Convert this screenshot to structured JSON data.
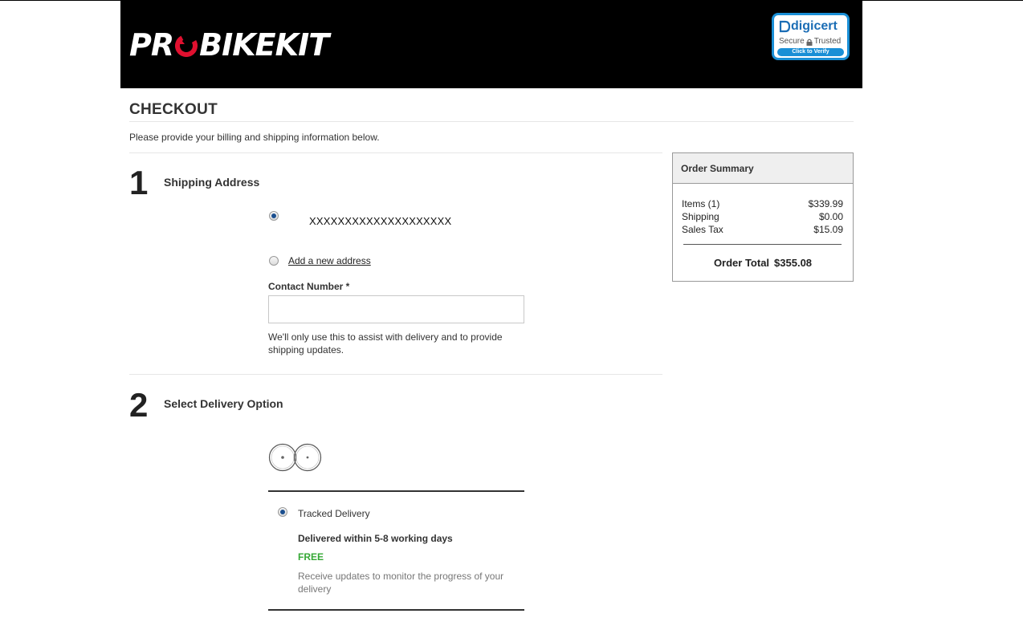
{
  "header": {
    "logo_before": "PR",
    "logo_after": "BIKEKIT",
    "seal": {
      "brand": "digicert",
      "secure": "Secure",
      "trusted": "Trusted",
      "verify": "Click to Verify"
    }
  },
  "checkout": {
    "title": "CHECKOUT",
    "intro": "Please provide your billing and shipping information below."
  },
  "shipping": {
    "step": "1",
    "title": "Shipping Address",
    "saved_address": "XXXXXXXXXXXXXXXXXXXX",
    "saved_address_selected": true,
    "add_new_label": "Add a new address",
    "contact_label": "Contact Number *",
    "contact_value": "",
    "contact_help": "We'll only use this to assist with delivery and to provide shipping updates."
  },
  "delivery": {
    "step": "2",
    "title": "Select Delivery Option",
    "option": {
      "name": "Tracked Delivery",
      "selected": true,
      "time": "Delivered within 5-8 working days",
      "price": "FREE",
      "description": "Receive updates to monitor the progress of your delivery"
    }
  },
  "summary": {
    "title": "Order Summary",
    "rows": [
      {
        "label": "Items (1)",
        "value": "$339.99"
      },
      {
        "label": "Shipping",
        "value": "$0.00"
      },
      {
        "label": "Sales Tax",
        "value": "$15.09"
      }
    ],
    "total_label": "Order Total",
    "total_value": "$355.08"
  },
  "colors": {
    "header_bg": "#000000",
    "logo_accent": "#e0102f",
    "seal_blue": "#1a8fd6",
    "price_green": "#35a835",
    "radio_dot": "#1b4f8f"
  },
  "icons": [
    "logo-o-swirl-icon",
    "digicert-seal-icon",
    "lock-icon",
    "bike-wheels-icon"
  ]
}
